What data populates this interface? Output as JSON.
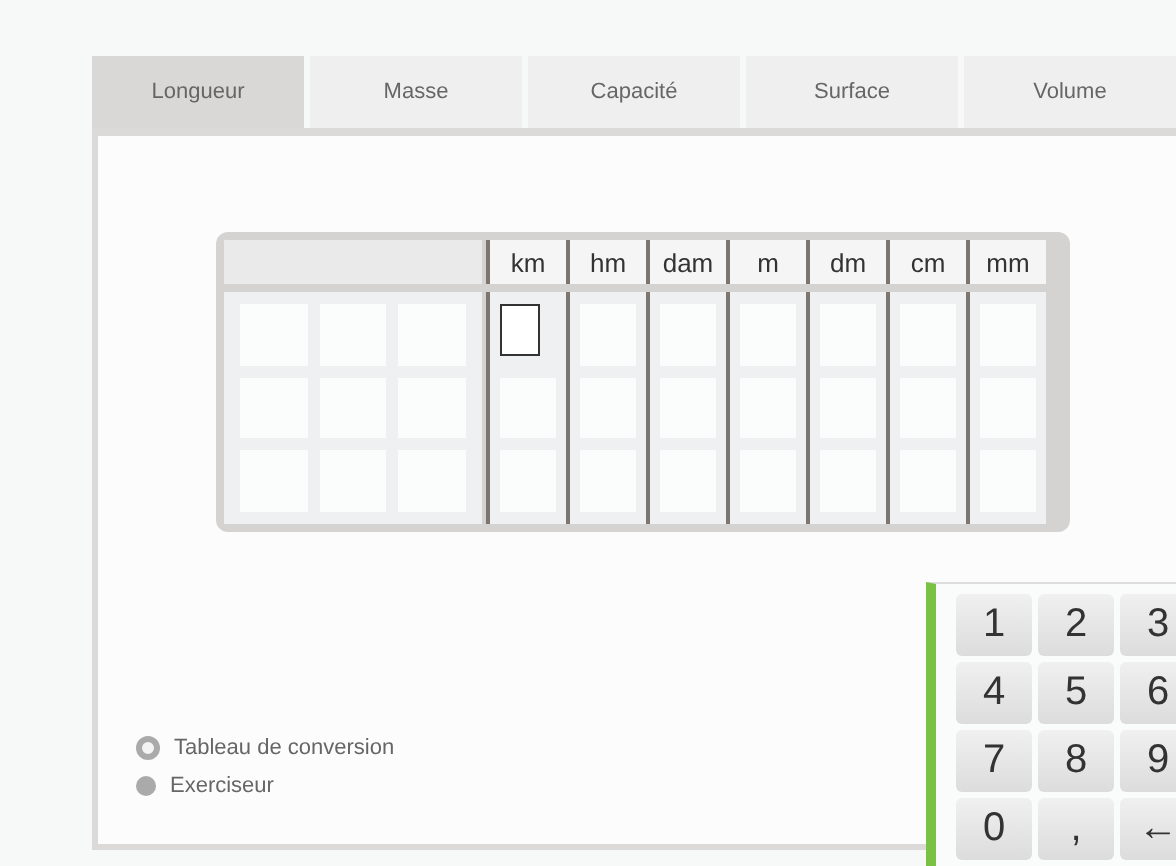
{
  "tabs": [
    {
      "label": "Longueur",
      "selected": true
    },
    {
      "label": "Masse",
      "selected": false
    },
    {
      "label": "Capacité",
      "selected": false
    },
    {
      "label": "Surface",
      "selected": false
    },
    {
      "label": "Volume",
      "selected": false
    }
  ],
  "table": {
    "columns": [
      {
        "label": "km",
        "cells": [
          {
            "selected": true
          },
          {
            "selected": false
          },
          {
            "selected": false
          }
        ]
      },
      {
        "label": "hm",
        "cells": [
          {
            "selected": false
          },
          {
            "selected": false
          },
          {
            "selected": false
          }
        ]
      },
      {
        "label": "dam",
        "cells": [
          {
            "selected": false
          },
          {
            "selected": false
          },
          {
            "selected": false
          }
        ]
      },
      {
        "label": "m",
        "cells": [
          {
            "selected": false
          },
          {
            "selected": false
          },
          {
            "selected": false
          }
        ]
      },
      {
        "label": "dm",
        "cells": [
          {
            "selected": false
          },
          {
            "selected": false
          },
          {
            "selected": false
          }
        ]
      },
      {
        "label": "cm",
        "cells": [
          {
            "selected": false
          },
          {
            "selected": false
          },
          {
            "selected": false
          }
        ]
      },
      {
        "label": "mm",
        "cells": [
          {
            "selected": false
          },
          {
            "selected": false
          },
          {
            "selected": false
          }
        ]
      }
    ]
  },
  "modes": [
    {
      "label": "Tableau de conversion",
      "selected": true
    },
    {
      "label": "Exerciseur",
      "selected": false
    }
  ],
  "keypad": [
    "1",
    "2",
    "3",
    "4",
    "5",
    "6",
    "7",
    "8",
    "9",
    "0",
    ",",
    "←"
  ]
}
